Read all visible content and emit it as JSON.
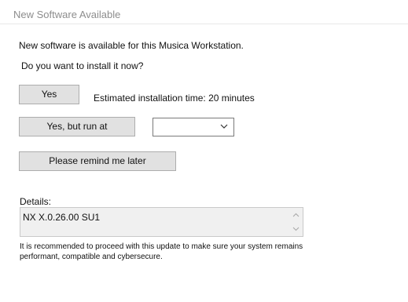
{
  "window": {
    "title": "New Software Available"
  },
  "message": {
    "line1": "New software is available for this Musica Workstation.",
    "line2": "Do you want to install it now?"
  },
  "actions": {
    "yes_label": "Yes",
    "estimate_text": "Estimated installation time: 20 minutes",
    "run_at_label": "Yes, but run at",
    "run_at_selected_value": "",
    "remind_label": "Please remind me later"
  },
  "details": {
    "label": "Details:",
    "value": "NX X.0.26.00 SU1"
  },
  "note": {
    "text": "It is recommended to proceed with this update to make sure your system remains performant, compatible and cybersecure."
  },
  "icons": {
    "dropdown": "chevron-down-icon",
    "scroll_up": "scroll-up-arrow-icon",
    "scroll_down": "scroll-down-arrow-icon"
  }
}
